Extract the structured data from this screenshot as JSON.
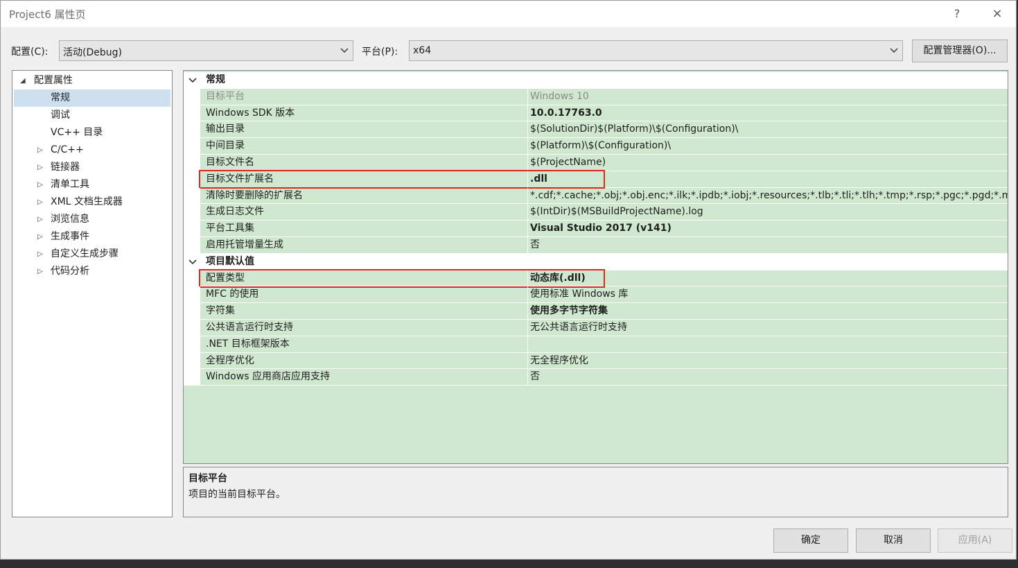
{
  "window": {
    "title": "Project6 属性页",
    "help_icon": "?",
    "close_icon": "×"
  },
  "toolbar": {
    "config_label": "配置(C):",
    "config_value": "活动(Debug)",
    "platform_label": "平台(P):",
    "platform_value": "x64",
    "config_manager_label": "配置管理器(O)..."
  },
  "tree": {
    "root": "配置属性",
    "items": [
      {
        "label": "常规",
        "selected": true
      },
      {
        "label": "调试"
      },
      {
        "label": "VC++ 目录"
      },
      {
        "label": "C/C++",
        "expandable": true
      },
      {
        "label": "链接器",
        "expandable": true
      },
      {
        "label": "清单工具",
        "expandable": true
      },
      {
        "label": "XML 文档生成器",
        "expandable": true
      },
      {
        "label": "浏览信息",
        "expandable": true
      },
      {
        "label": "生成事件",
        "expandable": true
      },
      {
        "label": "自定义生成步骤",
        "expandable": true
      },
      {
        "label": "代码分析",
        "expandable": true
      }
    ]
  },
  "grid": {
    "categories": [
      {
        "name": "常规",
        "props": [
          {
            "name": "目标平台",
            "value": "Windows 10",
            "disabled": true
          },
          {
            "name": "Windows SDK 版本",
            "value": "10.0.17763.0",
            "bold": true
          },
          {
            "name": "输出目录",
            "value": "$(SolutionDir)$(Platform)\\$(Configuration)\\"
          },
          {
            "name": "中间目录",
            "value": "$(Platform)\\$(Configuration)\\"
          },
          {
            "name": "目标文件名",
            "value": "$(ProjectName)"
          },
          {
            "name": "目标文件扩展名",
            "value": ".dll",
            "bold": true,
            "highlighted": true
          },
          {
            "name": "清除时要删除的扩展名",
            "value": "*.cdf;*.cache;*.obj;*.obj.enc;*.ilk;*.ipdb;*.iobj;*.resources;*.tlb;*.tli;*.tlh;*.tmp;*.rsp;*.pgc;*.pgd;*.met"
          },
          {
            "name": "生成日志文件",
            "value": "$(IntDir)$(MSBuildProjectName).log"
          },
          {
            "name": "平台工具集",
            "value": "Visual Studio 2017 (v141)",
            "bold": true
          },
          {
            "name": "启用托管增量生成",
            "value": "否"
          }
        ]
      },
      {
        "name": "项目默认值",
        "props": [
          {
            "name": "配置类型",
            "value": "动态库(.dll)",
            "bold": true,
            "highlighted": true
          },
          {
            "name": "MFC 的使用",
            "value": "使用标准 Windows 库"
          },
          {
            "name": "字符集",
            "value": "使用多字节字符集",
            "bold": true
          },
          {
            "name": "公共语言运行时支持",
            "value": "无公共语言运行时支持"
          },
          {
            "name": ".NET 目标框架版本",
            "value": ""
          },
          {
            "name": "全程序优化",
            "value": "无全程序优化"
          },
          {
            "name": "Windows 应用商店应用支持",
            "value": "否"
          }
        ]
      }
    ]
  },
  "description": {
    "title": "目标平台",
    "text": "项目的当前目标平台。"
  },
  "buttons": {
    "ok": "确定",
    "cancel": "取消",
    "apply": "应用(A)"
  },
  "colors": {
    "grid_background": "#cfe8cf",
    "highlight_border": "#e0241f",
    "tree_selected": "#cce0f0"
  }
}
